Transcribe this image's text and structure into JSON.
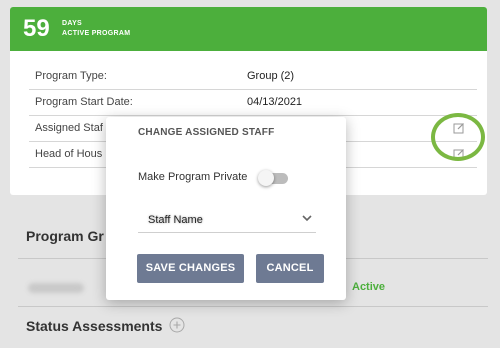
{
  "banner": {
    "days_count": "59",
    "days_label": "DAYS",
    "program_label": "ACTIVE PROGRAM"
  },
  "details": [
    {
      "label": "Program Type:",
      "value": "Group (2)"
    },
    {
      "label": "Program Start Date:",
      "value": "04/13/2021"
    },
    {
      "label": "Assigned Staf",
      "value": ""
    },
    {
      "label": "Head of Hous",
      "value": ""
    }
  ],
  "sections": {
    "program_group_title": "Program Gr",
    "status_text": "Active",
    "status_assessments_title": "Status Assessments"
  },
  "modal": {
    "title": "CHANGE ASSIGNED STAFF",
    "private_label": "Make Program Private",
    "private_enabled": false,
    "staff_select_value": "Staff Name",
    "save_label": "SAVE CHANGES",
    "cancel_label": "CANCEL"
  },
  "colors": {
    "accent_green": "#4caf3c",
    "highlight_ring": "#7bb842",
    "button": "#6e7a93"
  },
  "icons": {
    "edit": "edit-icon",
    "plus": "plus-circle-icon",
    "chevron": "chevron-down-icon"
  }
}
